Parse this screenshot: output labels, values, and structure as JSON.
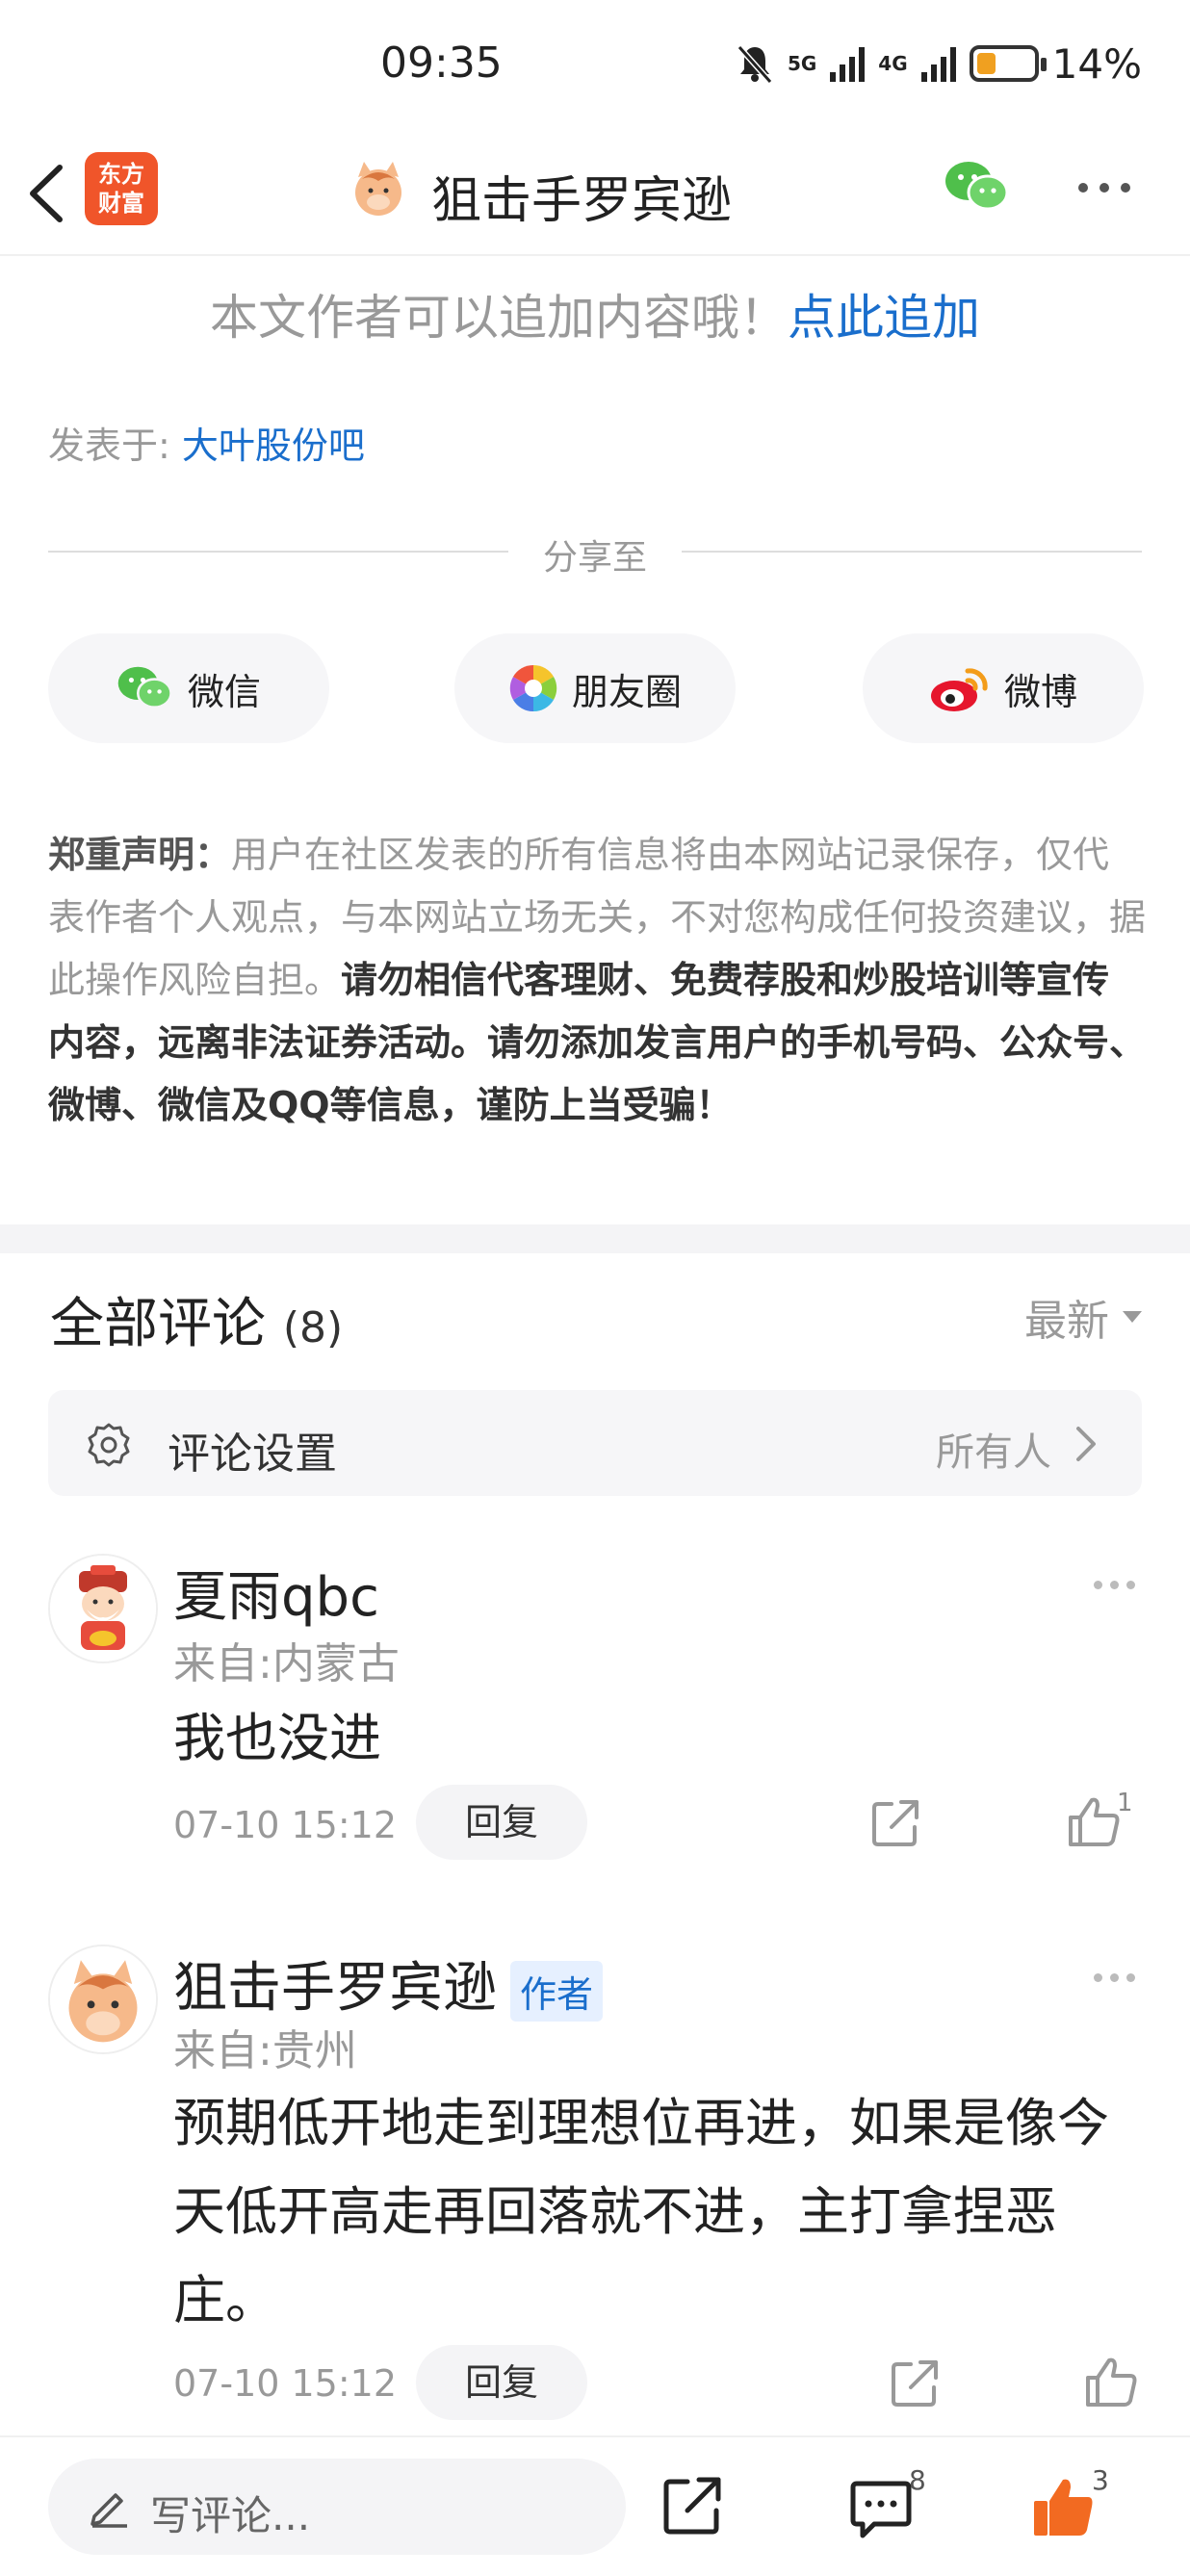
{
  "status_bar": {
    "time": "09:35",
    "net1": "5G",
    "net2": "4G",
    "battery": "14%",
    "battery_level": 0.14
  },
  "header": {
    "logo_line1": "东方",
    "logo_line2": "财富",
    "title": "狙击手罗宾逊"
  },
  "append": {
    "text": "本文作者可以追加内容哦！",
    "link": "点此追加"
  },
  "posted_in": {
    "label": "发表于:",
    "bar": "大叶股份吧"
  },
  "share": {
    "label": "分享至",
    "buttons": [
      {
        "label": "微信",
        "icon": "wechat-icon"
      },
      {
        "label": "朋友圈",
        "icon": "moments-icon"
      },
      {
        "label": "微博",
        "icon": "weibo-icon"
      }
    ]
  },
  "disclaimer": {
    "head": "郑重声明：",
    "normal": "用户在社区发表的所有信息将由本网站记录保存，仅代表作者个人观点，与本网站立场无关，不对您构成任何投资建议，据此操作风险自担。",
    "bold": "请勿相信代客理财、免费荐股和炒股培训等宣传内容，远离非法证券活动。请勿添加发言用户的手机号码、公众号、微博、微信及QQ等信息，谨防上当受骗！"
  },
  "comments_section": {
    "title": "全部评论",
    "count": "(8)",
    "sort": "最新",
    "settings_label": "评论设置",
    "settings_value": "所有人"
  },
  "comments": [
    {
      "name": "夏雨qbc",
      "from": "来自:内蒙古",
      "text": "我也没进",
      "time": "07-10 15:12",
      "reply": "回复",
      "likes": "1"
    },
    {
      "name": "狙击手罗宾逊",
      "tag": "作者",
      "from": "来自:贵州",
      "text": "预期低开地走到理想位再进，如果是像今天低开高走再回落就不进，主打拿捏恶庄。",
      "time": "07-10 15:12",
      "reply": "回复"
    }
  ],
  "bottom_bar": {
    "placeholder": "写评论...",
    "comment_count": "8",
    "like_count": "3"
  },
  "colors": {
    "link": "#1a6ecc",
    "brand": "#f0552a",
    "like": "#f26a21"
  }
}
